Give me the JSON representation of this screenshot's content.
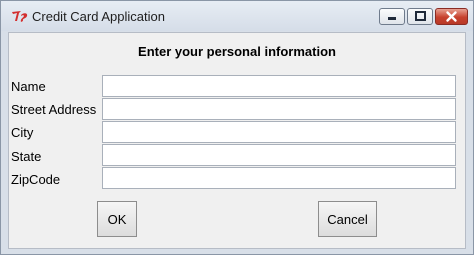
{
  "window": {
    "title": "Credit Card Application",
    "app_icon": "tk-feather-icon",
    "controls": [
      "minimize-icon",
      "maximize-icon",
      "close-icon"
    ]
  },
  "form": {
    "heading": "Enter your personal information",
    "fields": [
      {
        "label": "Name",
        "value": ""
      },
      {
        "label": "Street Address",
        "value": ""
      },
      {
        "label": "City",
        "value": ""
      },
      {
        "label": "State",
        "value": ""
      },
      {
        "label": "ZipCode",
        "value": ""
      }
    ]
  },
  "buttons": {
    "ok_label": "OK",
    "cancel_label": "Cancel"
  },
  "colors": {
    "close_button": "#c7412e",
    "icon_red": "#d32f2f",
    "client_background": "#f0f0f0"
  }
}
